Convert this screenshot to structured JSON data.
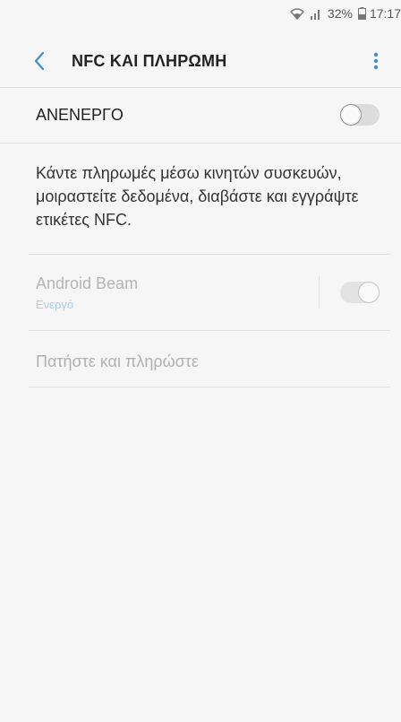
{
  "status_bar": {
    "wifi_icon": "wifi-icon",
    "signal_icon": "signal-icon",
    "battery_percent": "32%",
    "battery_icon": "battery-icon",
    "time": "17:17"
  },
  "header": {
    "back_icon": "chevron-left-icon",
    "title": "NFC ΚΑΙ ΠΛΗΡΩΜΗ",
    "more_icon": "more-vertical-icon"
  },
  "master_switch": {
    "label": "ΑΝΕΝΕΡΓΟ",
    "checked": false
  },
  "description": "Κάντε πληρωμές μέσω κινητών συσκευών, μοιραστείτε δεδομένα, διαβάστε και εγγράψτε ετικέτες NFC.",
  "android_beam": {
    "title": "Android Beam",
    "status": "Ενεργό",
    "checked": true,
    "enabled": false
  },
  "tap_and_pay": {
    "label": "Πατήστε και πληρώστε",
    "enabled": false
  },
  "colors": {
    "background": "#f6f6f6",
    "accent": "#3e8fcf",
    "disabled_text": "#b5b5b5",
    "status_link": "#a9cde6"
  }
}
